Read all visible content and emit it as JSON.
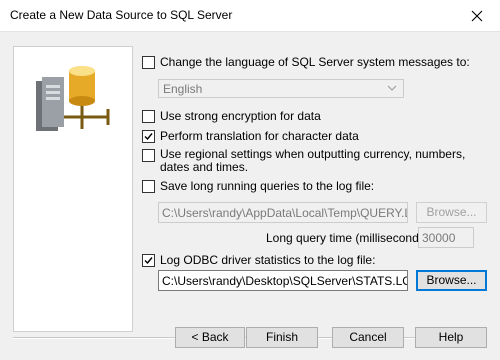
{
  "window": {
    "title": "Create a New Data Source to SQL Server"
  },
  "options": {
    "change_language": {
      "label": "Change the language of SQL Server system messages to:",
      "checked": false
    },
    "language": {
      "value": "English"
    },
    "strong_encryption": {
      "label": "Use strong encryption for data",
      "checked": false
    },
    "perform_translation": {
      "label": "Perform translation for character data",
      "checked": true
    },
    "regional_settings": {
      "label": "Use regional settings when outputting currency, numbers, dates and times.",
      "checked": false
    },
    "save_long_queries": {
      "label": "Save long running queries to the log file:",
      "checked": false
    },
    "query_log_path": "C:\\Users\\randy\\AppData\\Local\\Temp\\QUERY.LOG",
    "long_query_time_label": "Long query time (milliseconds):",
    "long_query_time_value": "30000",
    "log_odbc_stats": {
      "label": "Log ODBC driver statistics to the log file:",
      "checked": true
    },
    "stats_log_path": "C:\\Users\\randy\\Desktop\\SQLServer\\STATS.LOG",
    "browse_label": "Browse..."
  },
  "buttons": {
    "back": "< Back",
    "finish": "Finish",
    "cancel": "Cancel",
    "help": "Help"
  },
  "colors": {
    "window_bg": "#f0f0f0",
    "focus_border": "#0078d7",
    "disabled_text": "#7a7a7a"
  },
  "icons": [
    "close-icon",
    "database-server-icon",
    "check-icon",
    "chevron-down-icon"
  ]
}
